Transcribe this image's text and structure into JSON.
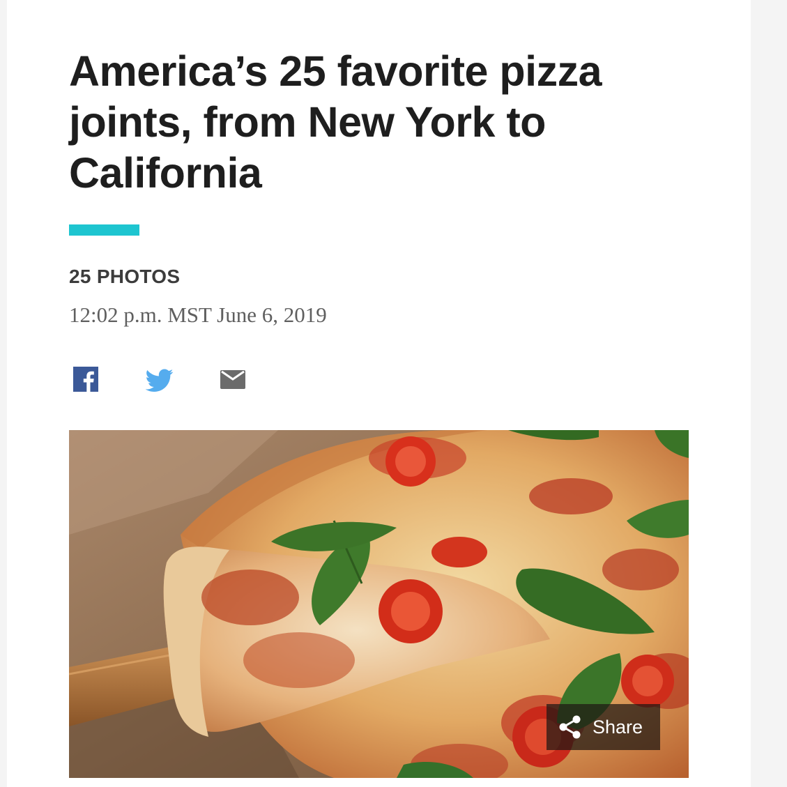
{
  "article": {
    "headline": "America’s 25 favorite pizza joints, from New York to California",
    "photo_count": "25 PHOTOS",
    "timestamp": "12:02 p.m. MST June 6, 2019"
  },
  "social": {
    "items": [
      {
        "icon": "facebook-icon",
        "color": "#3b5998"
      },
      {
        "icon": "twitter-icon",
        "color": "#55acee"
      },
      {
        "icon": "email-icon",
        "color": "#6b6b6b"
      }
    ]
  },
  "hero": {
    "share_label": "Share"
  },
  "colors": {
    "accent": "#1ec5d0",
    "headline": "#1e1e1e"
  }
}
